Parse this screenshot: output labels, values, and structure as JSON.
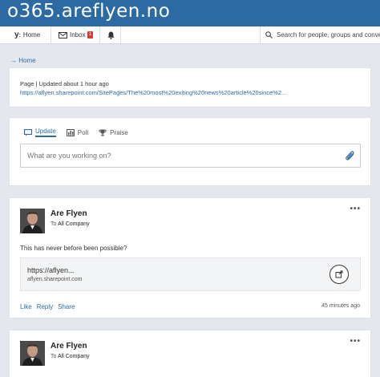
{
  "banner": {
    "title": "o365.areflyen.no"
  },
  "nav": {
    "home_label": "Home",
    "inbox_label": "Inbox",
    "inbox_count": "1",
    "bell_icon": "bell-icon",
    "search_placeholder": "Search for people, groups and conversations"
  },
  "breadcrumb": {
    "label": "→ Home"
  },
  "page_card": {
    "meta": "Page  |  Updated about 1 hour ago",
    "url": "https://aflyen.sharepoint.com/SitePages/The%20most%20exiting%20news%20article%20since%2..."
  },
  "publisher": {
    "tabs": [
      {
        "label": "Update",
        "icon": "update-icon"
      },
      {
        "label": "Poll",
        "icon": "poll-icon"
      },
      {
        "label": "Praise",
        "icon": "trophy-icon"
      }
    ],
    "placeholder": "What are you working on?"
  },
  "posts": [
    {
      "author": "Are Flyen",
      "to_prefix": "To",
      "to_group": "All Company",
      "more": "•••",
      "body": "This has never before been possible?",
      "link_title": "https://aflyen...",
      "link_domain": "aflyen.sharepoint.com",
      "actions": [
        "Like",
        "Reply",
        "Share"
      ],
      "time": "45 minutes ago"
    },
    {
      "author": "Are Flyen",
      "to_prefix": "To",
      "to_group": "All Company",
      "more": "•••"
    }
  ],
  "colors": {
    "brand": "#2c6aa4",
    "badge": "#d63a35",
    "background": "#e4e8ee"
  }
}
